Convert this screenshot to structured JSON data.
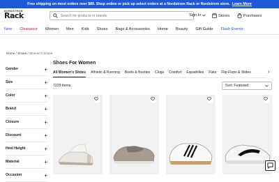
{
  "promo": {
    "text": "Free shipping on most orders over $89. Shop online or pick up select orders at a Nordstrom Rack or Nordstrom store.",
    "link": "Learn More"
  },
  "brand": {
    "line1": "NORDSTROM",
    "line2": "Rack"
  },
  "search": {
    "placeholder": "Search for products or brands"
  },
  "header": {
    "signin": "Sign In",
    "stores": "Stores",
    "purchases": "Purchases"
  },
  "nav": [
    "New",
    "Clearance",
    "Women",
    "Men",
    "Kids",
    "Shoes",
    "Bags & Accessories",
    "Home",
    "Beauty",
    "Gift Guide",
    "Flash Events"
  ],
  "colors": {
    "accent": "#1e58d6",
    "clearance": "#c8102e"
  },
  "breadcrumb": [
    "Home",
    "Shoes",
    "Women's Shoes"
  ],
  "filters": [
    "Gender",
    "Size",
    "Color",
    "Brand",
    "Closure",
    "Discount",
    "Heel Height",
    "Material",
    "Occasion"
  ],
  "page": {
    "title": "Shoes For Women",
    "categories": [
      "All Women's Shoes",
      "Athletic & Running",
      "Boots & Booties",
      "Clogs",
      "Comfort",
      "Espadrilles",
      "Flats",
      "Flip-Flops & Slides"
    ],
    "count": "7229 items",
    "sort": "Sort: Featured"
  },
  "products": [
    {
      "icon": "clear-heel-mule-image"
    },
    {
      "icon": "gray-slip-on-image"
    },
    {
      "icon": "white-black-stripe-sneaker-image"
    },
    {
      "icon": "white-black-runner-image"
    }
  ]
}
